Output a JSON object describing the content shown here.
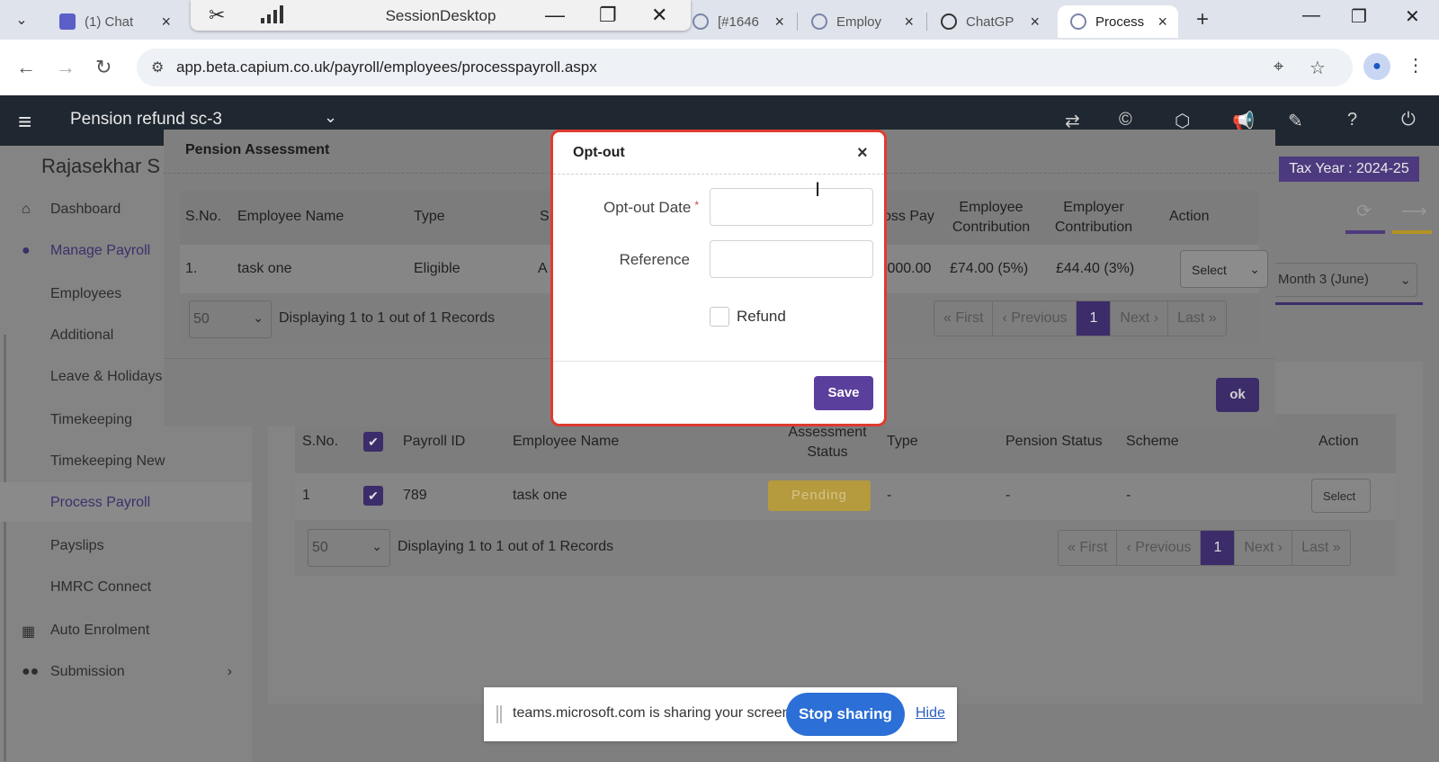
{
  "browser": {
    "tabs": [
      {
        "label": "(1) Chat"
      },
      {
        "label": "[#1646"
      },
      {
        "label": "Employ"
      },
      {
        "label": "ChatGP"
      },
      {
        "label": "Process"
      }
    ],
    "url": "app.beta.capium.co.uk/payroll/employees/processpayroll.aspx"
  },
  "session": {
    "title": "SessionDesktop"
  },
  "app": {
    "company": "Pension refund sc-3",
    "user_name": "Rajasekhar S",
    "tax_year": "Tax Year : 2024-25",
    "month_select": "Month 3 (June)",
    "sidebar": [
      {
        "label": "Dashboard",
        "icon": "home-icon"
      },
      {
        "label": "Manage Payroll",
        "icon": "user-icon"
      },
      {
        "label": "Employees"
      },
      {
        "label": "Additional"
      },
      {
        "label": "Leave & Holidays"
      },
      {
        "label": "Timekeeping"
      },
      {
        "label": "Timekeeping New"
      },
      {
        "label": "Process Payroll"
      },
      {
        "label": "Payslips"
      },
      {
        "label": "HMRC Connect"
      },
      {
        "label": "Auto Enrolment",
        "icon": "grid-icon"
      },
      {
        "label": "Submission",
        "icon": "users-icon"
      }
    ],
    "grid": {
      "headers": {
        "sno": "S.No.",
        "payroll_id": "Payroll ID",
        "employee_name": "Employee Name",
        "assessment_status": "Assessment Status",
        "type": "Type",
        "pension_status": "Pension Status",
        "scheme": "Scheme",
        "action": "Action"
      },
      "rows": [
        {
          "sno": "1",
          "payroll_id": "789",
          "employee_name": "task one",
          "assessment_status": "Pending",
          "type": "-",
          "pension_status": "-",
          "scheme": "-",
          "action": "Select"
        }
      ],
      "page_size": "50",
      "info": "Displaying 1 to 1 out of 1 Records",
      "pager": {
        "first": "« First",
        "prev": "‹ Previous",
        "current": "1",
        "next": "Next ›",
        "last": "Last »"
      }
    }
  },
  "pension_modal": {
    "title": "Pension Assessment",
    "headers": {
      "sno": "S.No.",
      "employee_name": "Employee Name",
      "type": "Type",
      "s_partial": "S",
      "gross_pay_partial": "oss Pay",
      "employee_contribution": "Employee Contribution",
      "employer_contribution": "Employer Contribution",
      "action": "Action"
    },
    "row": {
      "sno": "1.",
      "employee_name": "task one",
      "type": "Eligible",
      "s_partial": "A",
      "gross_pay_partial": ",000.00",
      "employee_contribution": "£74.00 (5%)",
      "employer_contribution": "£44.40 (3%)",
      "action": "Select"
    },
    "page_size": "50",
    "info": "Displaying 1 to 1 out of 1 Records",
    "pager": {
      "first": "« First",
      "prev": "‹ Previous",
      "current": "1",
      "next": "Next ›",
      "last": "Last »"
    },
    "ok": "ok"
  },
  "optout_modal": {
    "title": "Opt-out",
    "date_label": "Opt-out Date",
    "required_mark": "*",
    "date_value": "",
    "reference_label": "Reference",
    "reference_value": "",
    "refund_label": "Refund",
    "save": "Save"
  },
  "share_banner": {
    "message": "teams.microsoft.com is sharing your screen.",
    "stop": "Stop sharing",
    "hide": "Hide"
  },
  "colors": {
    "accent": "#5a3f9c",
    "highlight": "#e03a2f",
    "pending": "#f2c94c",
    "share_button": "#2c6fd6"
  }
}
